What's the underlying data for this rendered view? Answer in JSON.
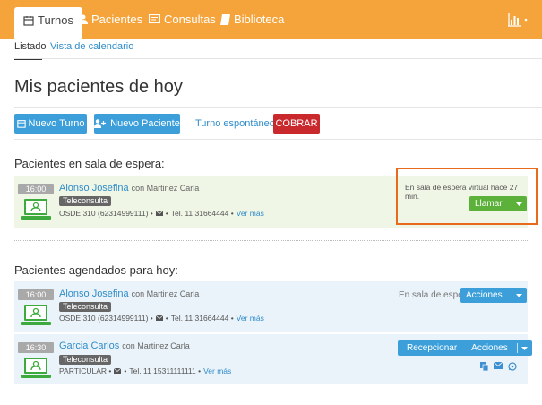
{
  "nav": {
    "tabs": [
      {
        "label": "Turnos",
        "active": true,
        "icon": "calendar-icon"
      },
      {
        "label": "Pacientes",
        "active": false,
        "icon": "user-icon"
      },
      {
        "label": "Consultas",
        "active": false,
        "icon": "chat-icon"
      },
      {
        "label": "Biblioteca",
        "active": false,
        "icon": "book-icon"
      }
    ],
    "stats_icon": "bar-chart-icon",
    "accent": "#f5a43b"
  },
  "subnav": {
    "tabs": [
      {
        "label": "Listado",
        "active": true
      },
      {
        "label": "Vista de calendario",
        "active": false
      }
    ]
  },
  "page": {
    "title": "Mis pacientes de hoy"
  },
  "actions": {
    "nuevo_turno": "Nuevo Turno",
    "nuevo_paciente": "Nuevo Paciente",
    "turno_espontaneo": "Turno espontáneo",
    "cobrar": "COBRAR"
  },
  "waiting": {
    "title": "Pacientes en sala de espera:",
    "items": [
      {
        "time": "16:00",
        "name": "Alonso Josefina",
        "with": "con Martinez Carla",
        "badge": "Teleconsulta",
        "coverage": "OSDE 310 (62314999111)",
        "phone": "Tel. 11 31664444",
        "more": "Ver más",
        "status": "En sala de espera virtual hace 27 min.",
        "action": "Llamar"
      }
    ]
  },
  "scheduled": {
    "title": "Pacientes agendados para hoy:",
    "items": [
      {
        "time": "16:00",
        "name": "Alonso Josefina",
        "with": "con Martinez Carla",
        "badge": "Teleconsulta",
        "coverage": "OSDE 310 (62314999111)",
        "phone": "Tel. 11 31664444",
        "more": "Ver más",
        "status": "En sala de espera",
        "action": "Acciones"
      },
      {
        "time": "16:30",
        "name": "Garcia Carlos",
        "with": "con Martinez Carla",
        "badge": "Teleconsulta",
        "coverage": "PARTICULAR",
        "phone": "Tel. 11 15311111111",
        "more": "Ver más",
        "receive": "Recepcionar",
        "action": "Acciones"
      }
    ]
  },
  "colors": {
    "green_btn": "#5cb13a",
    "blue_btn": "#3c9fda",
    "red_btn": "#c9282d",
    "highlight": "#e86a1c"
  }
}
